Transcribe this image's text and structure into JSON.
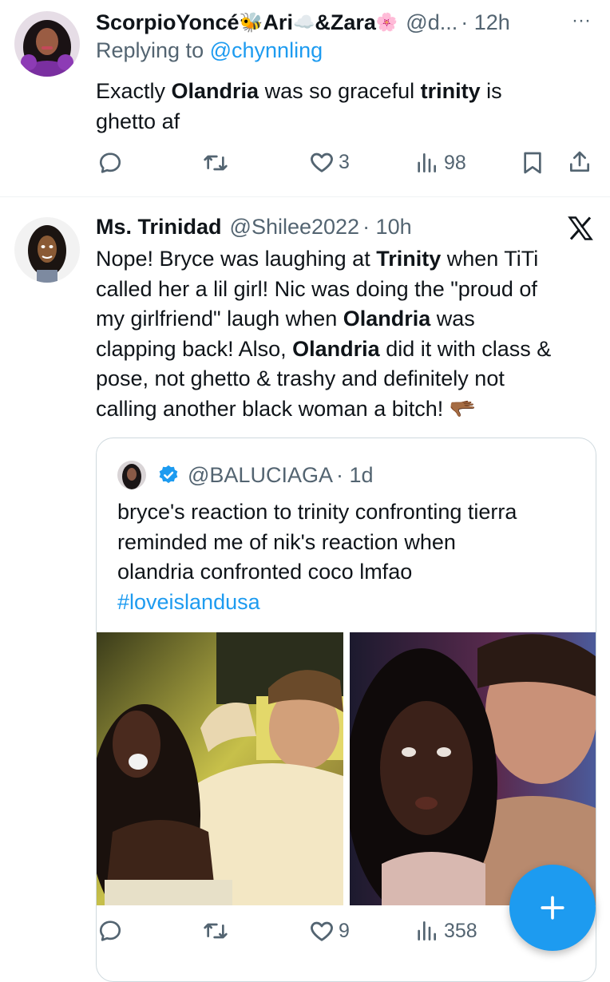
{
  "tweet1": {
    "display_name": "ScorpioYoncé",
    "name_emoji1": "🐝",
    "name_part2": "Ari",
    "name_emoji2": "☁️",
    "name_part3": "&Zara",
    "name_emoji3": "🌸",
    "handle": "@d...",
    "time": "· 12h",
    "more": "···",
    "replying_prefix": "Replying to",
    "replying_to": "@chynnling",
    "text_segments": [
      {
        "t": "Exactly ",
        "b": false
      },
      {
        "t": "Olandria",
        "b": true
      },
      {
        "t": " was so graceful ",
        "b": false
      },
      {
        "t": "trinity",
        "b": true
      },
      {
        "t": " is",
        "b": false
      }
    ],
    "text_line2": "ghetto af",
    "likes": "3",
    "views": "98"
  },
  "tweet2": {
    "display_name": "Ms. Trinidad",
    "handle": "@Shilee2022",
    "time": "· 10h",
    "lines": [
      [
        {
          "t": "Nope! Bryce was laughing at ",
          "b": false
        },
        {
          "t": "Trinity",
          "b": true
        },
        {
          "t": " when TiTi",
          "b": false
        }
      ],
      [
        {
          "t": "called her a lil girl! Nic was doing the \"proud of",
          "b": false
        }
      ],
      [
        {
          "t": "my girlfriend\" laugh when ",
          "b": false
        },
        {
          "t": "Olandria",
          "b": true
        },
        {
          "t": " was",
          "b": false
        }
      ],
      [
        {
          "t": "clapping back! Also, ",
          "b": false
        },
        {
          "t": "Olandria",
          "b": true
        },
        {
          "t": " did it with class &",
          "b": false
        }
      ],
      [
        {
          "t": "pose, not ghetto & trashy and definitely not",
          "b": false
        }
      ],
      [
        {
          "t": "calling another black woman a bitch! ",
          "b": false
        },
        {
          "t": "🫳🏾",
          "b": false
        }
      ]
    ],
    "likes": "9",
    "views": "358"
  },
  "quote": {
    "handle": "@BALUCIAGA",
    "time": "· 1d",
    "lines": [
      "bryce's reaction to trinity confronting tierra",
      "reminded me of nik's reaction when",
      "olandria confronted coco lmfao"
    ],
    "hashtag": "#loveislandusa"
  },
  "icons": {
    "reply": "reply-icon",
    "retweet": "retweet-icon",
    "like": "heart-icon",
    "views": "views-icon",
    "bookmark": "bookmark-icon",
    "share": "share-icon",
    "x_logo": "x-logo-icon",
    "verified": "verified-badge-icon",
    "compose": "plus-icon"
  },
  "colors": {
    "accent": "#1d9bf0",
    "secondary_text": "#536471",
    "border": "#cfd9de"
  }
}
